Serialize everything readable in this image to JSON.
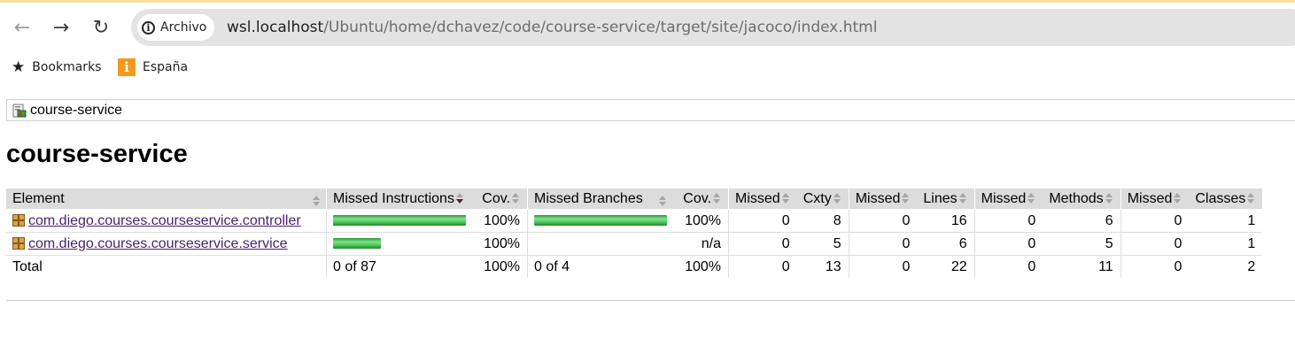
{
  "browser": {
    "security_chip": "Archivo",
    "url_host": "wsl.localhost",
    "url_path": "/Ubuntu/home/dchavez/code/course-service/target/site/jacoco/index.html",
    "icons": {
      "back": "back-arrow-icon",
      "forward": "forward-arrow-icon",
      "reload": "reload-icon",
      "info": "info-icon"
    }
  },
  "bookmarks": {
    "items": [
      {
        "label": "Bookmarks",
        "icon": "star-icon"
      },
      {
        "label": "España",
        "icon": "site-icon"
      }
    ]
  },
  "breadcrumb": {
    "label": "course-service",
    "icon": "report-icon"
  },
  "page": {
    "title": "course-service"
  },
  "table": {
    "headers": {
      "element": "Element",
      "missed_instructions": "Missed Instructions",
      "cov1": "Cov.",
      "missed_branches": "Missed Branches",
      "cov2": "Cov.",
      "missed_cxty": "Missed",
      "cxty": "Cxty",
      "missed_lines": "Missed",
      "lines": "Lines",
      "missed_methods": "Missed",
      "methods": "Methods",
      "missed_classes": "Missed",
      "classes": "Classes"
    },
    "rows": [
      {
        "element": "com.diego.courses.courseservice.controller",
        "instr_coverage_fraction": 1.0,
        "instr_bar_scale": 1.0,
        "cov1": "100%",
        "branch_coverage_fraction": 1.0,
        "branch_bar_scale": 1.0,
        "cov2": "100%",
        "missed_cxty": "0",
        "cxty": "8",
        "missed_lines": "0",
        "lines": "16",
        "missed_methods": "0",
        "methods": "6",
        "missed_classes": "0",
        "classes": "1"
      },
      {
        "element": "com.diego.courses.courseservice.service",
        "instr_coverage_fraction": 1.0,
        "instr_bar_scale": 0.36,
        "cov1": "100%",
        "branch_coverage_fraction": 0,
        "branch_bar_scale": 0,
        "cov2": "n/a",
        "missed_cxty": "0",
        "cxty": "5",
        "missed_lines": "0",
        "lines": "6",
        "missed_methods": "0",
        "methods": "5",
        "missed_classes": "0",
        "classes": "1"
      }
    ],
    "total": {
      "label": "Total",
      "missed_instructions": "0 of 87",
      "cov1": "100%",
      "missed_branches": "0 of 4",
      "cov2": "100%",
      "missed_cxty": "0",
      "cxty": "13",
      "missed_lines": "0",
      "lines": "22",
      "missed_methods": "0",
      "methods": "11",
      "missed_classes": "0",
      "classes": "2"
    },
    "colors": {
      "bar_green": "#3fbf4a",
      "header_bg": "#dcdcdc",
      "link": "#4b226c"
    }
  }
}
